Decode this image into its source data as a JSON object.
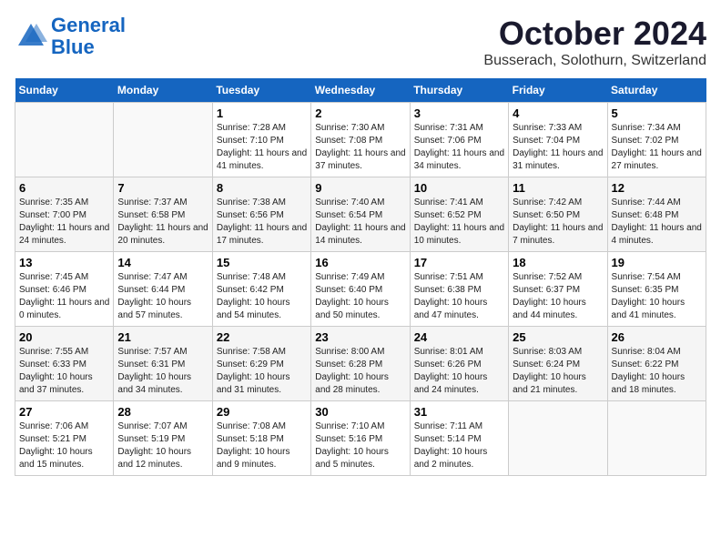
{
  "header": {
    "logo_line1": "General",
    "logo_line2": "Blue",
    "month_title": "October 2024",
    "location": "Busserach, Solothurn, Switzerland"
  },
  "days_of_week": [
    "Sunday",
    "Monday",
    "Tuesday",
    "Wednesday",
    "Thursday",
    "Friday",
    "Saturday"
  ],
  "weeks": [
    [
      {
        "day": "",
        "sunrise": "",
        "sunset": "",
        "daylight": ""
      },
      {
        "day": "",
        "sunrise": "",
        "sunset": "",
        "daylight": ""
      },
      {
        "day": "1",
        "sunrise": "Sunrise: 7:28 AM",
        "sunset": "Sunset: 7:10 PM",
        "daylight": "Daylight: 11 hours and 41 minutes."
      },
      {
        "day": "2",
        "sunrise": "Sunrise: 7:30 AM",
        "sunset": "Sunset: 7:08 PM",
        "daylight": "Daylight: 11 hours and 37 minutes."
      },
      {
        "day": "3",
        "sunrise": "Sunrise: 7:31 AM",
        "sunset": "Sunset: 7:06 PM",
        "daylight": "Daylight: 11 hours and 34 minutes."
      },
      {
        "day": "4",
        "sunrise": "Sunrise: 7:33 AM",
        "sunset": "Sunset: 7:04 PM",
        "daylight": "Daylight: 11 hours and 31 minutes."
      },
      {
        "day": "5",
        "sunrise": "Sunrise: 7:34 AM",
        "sunset": "Sunset: 7:02 PM",
        "daylight": "Daylight: 11 hours and 27 minutes."
      }
    ],
    [
      {
        "day": "6",
        "sunrise": "Sunrise: 7:35 AM",
        "sunset": "Sunset: 7:00 PM",
        "daylight": "Daylight: 11 hours and 24 minutes."
      },
      {
        "day": "7",
        "sunrise": "Sunrise: 7:37 AM",
        "sunset": "Sunset: 6:58 PM",
        "daylight": "Daylight: 11 hours and 20 minutes."
      },
      {
        "day": "8",
        "sunrise": "Sunrise: 7:38 AM",
        "sunset": "Sunset: 6:56 PM",
        "daylight": "Daylight: 11 hours and 17 minutes."
      },
      {
        "day": "9",
        "sunrise": "Sunrise: 7:40 AM",
        "sunset": "Sunset: 6:54 PM",
        "daylight": "Daylight: 11 hours and 14 minutes."
      },
      {
        "day": "10",
        "sunrise": "Sunrise: 7:41 AM",
        "sunset": "Sunset: 6:52 PM",
        "daylight": "Daylight: 11 hours and 10 minutes."
      },
      {
        "day": "11",
        "sunrise": "Sunrise: 7:42 AM",
        "sunset": "Sunset: 6:50 PM",
        "daylight": "Daylight: 11 hours and 7 minutes."
      },
      {
        "day": "12",
        "sunrise": "Sunrise: 7:44 AM",
        "sunset": "Sunset: 6:48 PM",
        "daylight": "Daylight: 11 hours and 4 minutes."
      }
    ],
    [
      {
        "day": "13",
        "sunrise": "Sunrise: 7:45 AM",
        "sunset": "Sunset: 6:46 PM",
        "daylight": "Daylight: 11 hours and 0 minutes."
      },
      {
        "day": "14",
        "sunrise": "Sunrise: 7:47 AM",
        "sunset": "Sunset: 6:44 PM",
        "daylight": "Daylight: 10 hours and 57 minutes."
      },
      {
        "day": "15",
        "sunrise": "Sunrise: 7:48 AM",
        "sunset": "Sunset: 6:42 PM",
        "daylight": "Daylight: 10 hours and 54 minutes."
      },
      {
        "day": "16",
        "sunrise": "Sunrise: 7:49 AM",
        "sunset": "Sunset: 6:40 PM",
        "daylight": "Daylight: 10 hours and 50 minutes."
      },
      {
        "day": "17",
        "sunrise": "Sunrise: 7:51 AM",
        "sunset": "Sunset: 6:38 PM",
        "daylight": "Daylight: 10 hours and 47 minutes."
      },
      {
        "day": "18",
        "sunrise": "Sunrise: 7:52 AM",
        "sunset": "Sunset: 6:37 PM",
        "daylight": "Daylight: 10 hours and 44 minutes."
      },
      {
        "day": "19",
        "sunrise": "Sunrise: 7:54 AM",
        "sunset": "Sunset: 6:35 PM",
        "daylight": "Daylight: 10 hours and 41 minutes."
      }
    ],
    [
      {
        "day": "20",
        "sunrise": "Sunrise: 7:55 AM",
        "sunset": "Sunset: 6:33 PM",
        "daylight": "Daylight: 10 hours and 37 minutes."
      },
      {
        "day": "21",
        "sunrise": "Sunrise: 7:57 AM",
        "sunset": "Sunset: 6:31 PM",
        "daylight": "Daylight: 10 hours and 34 minutes."
      },
      {
        "day": "22",
        "sunrise": "Sunrise: 7:58 AM",
        "sunset": "Sunset: 6:29 PM",
        "daylight": "Daylight: 10 hours and 31 minutes."
      },
      {
        "day": "23",
        "sunrise": "Sunrise: 8:00 AM",
        "sunset": "Sunset: 6:28 PM",
        "daylight": "Daylight: 10 hours and 28 minutes."
      },
      {
        "day": "24",
        "sunrise": "Sunrise: 8:01 AM",
        "sunset": "Sunset: 6:26 PM",
        "daylight": "Daylight: 10 hours and 24 minutes."
      },
      {
        "day": "25",
        "sunrise": "Sunrise: 8:03 AM",
        "sunset": "Sunset: 6:24 PM",
        "daylight": "Daylight: 10 hours and 21 minutes."
      },
      {
        "day": "26",
        "sunrise": "Sunrise: 8:04 AM",
        "sunset": "Sunset: 6:22 PM",
        "daylight": "Daylight: 10 hours and 18 minutes."
      }
    ],
    [
      {
        "day": "27",
        "sunrise": "Sunrise: 7:06 AM",
        "sunset": "Sunset: 5:21 PM",
        "daylight": "Daylight: 10 hours and 15 minutes."
      },
      {
        "day": "28",
        "sunrise": "Sunrise: 7:07 AM",
        "sunset": "Sunset: 5:19 PM",
        "daylight": "Daylight: 10 hours and 12 minutes."
      },
      {
        "day": "29",
        "sunrise": "Sunrise: 7:08 AM",
        "sunset": "Sunset: 5:18 PM",
        "daylight": "Daylight: 10 hours and 9 minutes."
      },
      {
        "day": "30",
        "sunrise": "Sunrise: 7:10 AM",
        "sunset": "Sunset: 5:16 PM",
        "daylight": "Daylight: 10 hours and 5 minutes."
      },
      {
        "day": "31",
        "sunrise": "Sunrise: 7:11 AM",
        "sunset": "Sunset: 5:14 PM",
        "daylight": "Daylight: 10 hours and 2 minutes."
      },
      {
        "day": "",
        "sunrise": "",
        "sunset": "",
        "daylight": ""
      },
      {
        "day": "",
        "sunrise": "",
        "sunset": "",
        "daylight": ""
      }
    ]
  ]
}
